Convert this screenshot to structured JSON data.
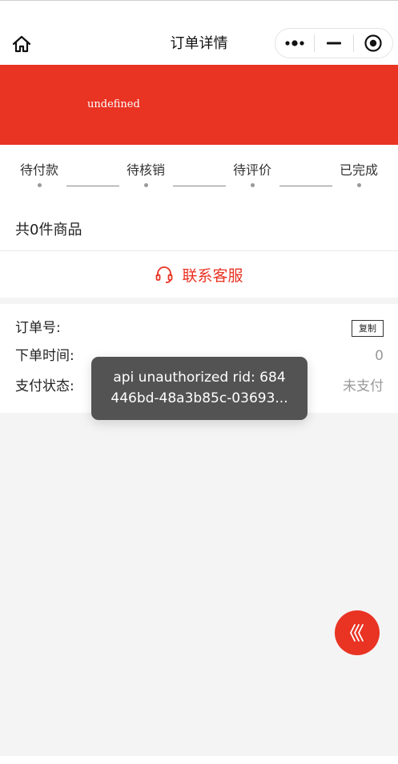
{
  "navbar": {
    "title": "订单详情",
    "home_icon": "home-icon",
    "capsule": {
      "more_icon": "more-dots-icon",
      "minimize_icon": "minimize-icon",
      "close_icon": "target-close-icon"
    }
  },
  "banner": {
    "text": "undefined",
    "color": "#e93323"
  },
  "steps": [
    {
      "label": "待付款"
    },
    {
      "label": "待核销"
    },
    {
      "label": "待评价"
    },
    {
      "label": "已完成"
    }
  ],
  "goods": {
    "count_text": "共0件商品"
  },
  "service": {
    "label": "联系客服",
    "icon": "headset-icon",
    "color": "#e93323"
  },
  "order_info": {
    "order_no_label": "订单号:",
    "order_no_value": "",
    "copy_label": "复制",
    "order_time_label": "下单时间:",
    "order_time_value": "0",
    "pay_status_label": "支付状态:",
    "pay_status_value": "未支付"
  },
  "toast": {
    "line1": "api unauthorized rid: 684",
    "line2": "446bd-48a3b85c-03693..."
  },
  "fab": {
    "icon": "chevrons-left-icon"
  }
}
